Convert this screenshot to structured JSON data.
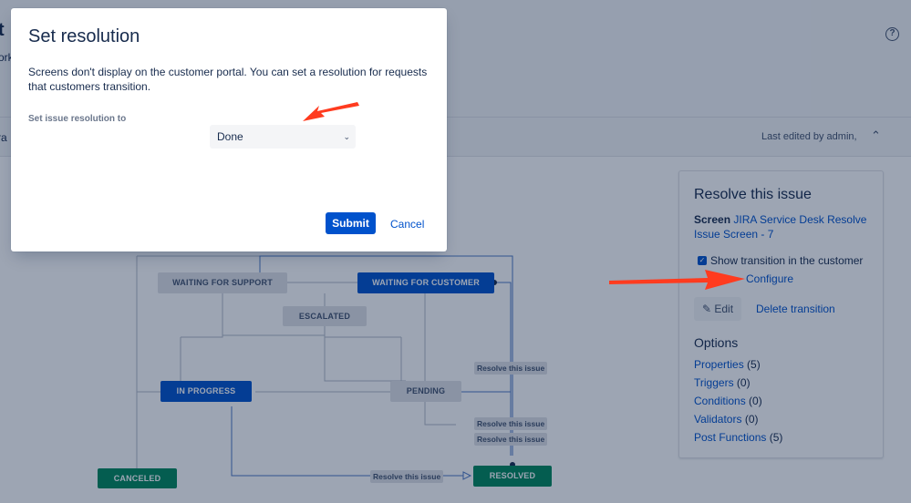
{
  "page": {
    "title_fragment": "t",
    "subtitle_fragment": "ork",
    "help_icon": "question-circle-icon"
  },
  "diagram_header": {
    "tab_fragment": "ra",
    "last_edited": "Last edited by admin,",
    "collapse_icon": "chevron-double-up-icon"
  },
  "workflow": {
    "statuses": {
      "waiting_support": "WAITING FOR SUPPORT",
      "waiting_customer": "WAITING FOR CUSTOMER",
      "escalated": "ESCALATED",
      "in_progress": "IN PROGRESS",
      "pending": "PENDING",
      "canceled": "CANCELED",
      "resolved": "RESOLVED"
    },
    "transition_label": "Resolve this issue"
  },
  "side_panel": {
    "title": "Resolve this issue",
    "screen_label": "Screen",
    "screen_value": "JIRA Service Desk Resolve Issue Screen - 7",
    "show_transition_label": "Show transition in the customer",
    "show_transition_checked": true,
    "configure_link": "Configure",
    "edit_button": "Edit",
    "edit_icon": "pencil-icon",
    "delete_link": "Delete transition",
    "options_heading": "Options",
    "options": [
      {
        "label": "Properties",
        "count": "(5)"
      },
      {
        "label": "Triggers",
        "count": "(0)"
      },
      {
        "label": "Conditions",
        "count": "(0)"
      },
      {
        "label": "Validators",
        "count": "(0)"
      },
      {
        "label": "Post Functions",
        "count": "(5)"
      }
    ]
  },
  "modal": {
    "title": "Set resolution",
    "description": "Screens don't display on the customer portal. You can set a resolution for requests that customers transition.",
    "field_label": "Set issue resolution to",
    "select_value": "Done",
    "submit_label": "Submit",
    "cancel_label": "Cancel"
  },
  "colors": {
    "primary": "#0052cc",
    "status_grey": "#dfe1e6",
    "status_green": "#00875a",
    "annotation_arrow": "#ff3b1f",
    "overlay": "rgba(9,30,66,0.40)"
  }
}
